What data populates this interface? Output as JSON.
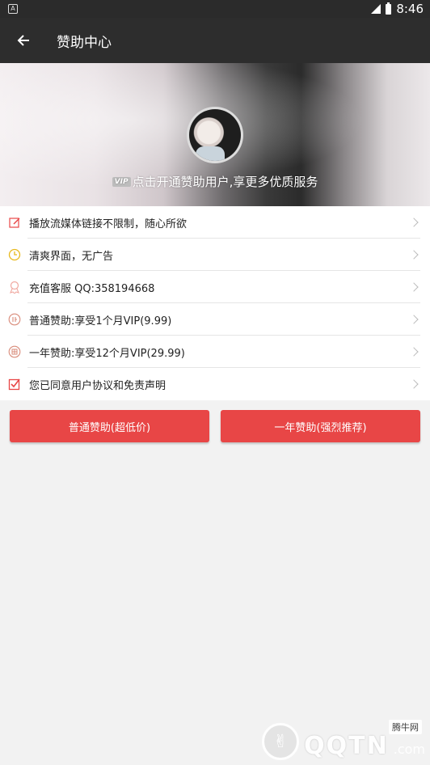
{
  "statusbar": {
    "time": "8:46"
  },
  "toolbar": {
    "title": "赞助中心"
  },
  "banner": {
    "vip": "VIP",
    "caption": "点击开通赞助用户,享更多优质服务"
  },
  "items": [
    {
      "icon": "edit-icon",
      "label": "播放流媒体链接不限制，随心所欲"
    },
    {
      "icon": "clock-icon",
      "label": "清爽界面，无广告"
    },
    {
      "icon": "medal-icon",
      "label": "充值客服 QQ:358194668"
    },
    {
      "icon": "ordinary-sponsor-icon",
      "label": "普通赞助:享受1个月VIP(9.99)"
    },
    {
      "icon": "annual-sponsor-icon",
      "label": "一年赞助:享受12个月VIP(29.99)"
    },
    {
      "icon": "checkbox-icon",
      "label": "您已同意用户协议和免责声明"
    }
  ],
  "buttons": {
    "basic": "普通赞助(超低价)",
    "annual": "一年赞助(强烈推荐)"
  },
  "watermark": {
    "site": "腾牛网",
    "brand": "QQTN",
    "suffix": ".com"
  },
  "colors": {
    "accent": "#e84646",
    "toolbar": "#2d2d2d"
  }
}
